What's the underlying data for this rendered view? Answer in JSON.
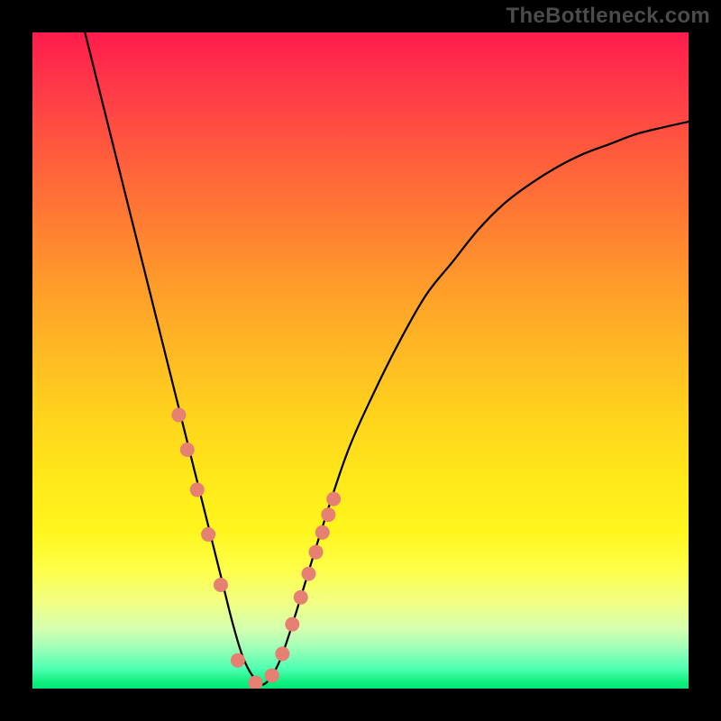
{
  "watermark": {
    "text": "TheBottleneck.com"
  },
  "chart_data": {
    "type": "line",
    "title": "",
    "xlabel": "",
    "ylabel": "",
    "xlim": [
      0,
      100
    ],
    "ylim": [
      0,
      100
    ],
    "grid": false,
    "legend": false,
    "series": [
      {
        "name": "bottleneck-curve",
        "x": [
          8,
          10,
          12,
          14,
          16,
          18,
          20,
          22,
          24,
          26,
          27.5,
          29,
          30.5,
          32,
          33.5,
          35,
          36.5,
          38,
          40,
          44,
          48,
          52,
          56,
          60,
          64,
          68,
          72,
          76,
          80,
          84,
          88,
          92,
          96,
          100
        ],
        "y": [
          100,
          92,
          84,
          76,
          68,
          60,
          52,
          44,
          36,
          28,
          22,
          16,
          10,
          5,
          2,
          0.6,
          2,
          5,
          11,
          24,
          36,
          45,
          53,
          60,
          65,
          70,
          74,
          77,
          79.5,
          81.5,
          83,
          84.5,
          85.5,
          86.4
        ],
        "stroke": "#000000",
        "stroke_width": 2.25,
        "markers": false
      },
      {
        "name": "highlight-beads",
        "x": [
          22.3,
          23.6,
          25.1,
          26.8,
          28.7,
          31.3,
          34.0,
          36.5,
          38.1,
          39.6,
          40.9,
          42.1,
          43.2,
          44.2,
          45.1,
          45.9
        ],
        "y": [
          41.7,
          36.4,
          30.3,
          23.5,
          15.8,
          4.3,
          0.9,
          2.0,
          5.3,
          9.8,
          13.9,
          17.5,
          20.8,
          23.8,
          26.5,
          28.9
        ],
        "stroke": "none",
        "markers": true,
        "marker_fill": "#e58073",
        "marker_r_px": 8
      }
    ]
  }
}
